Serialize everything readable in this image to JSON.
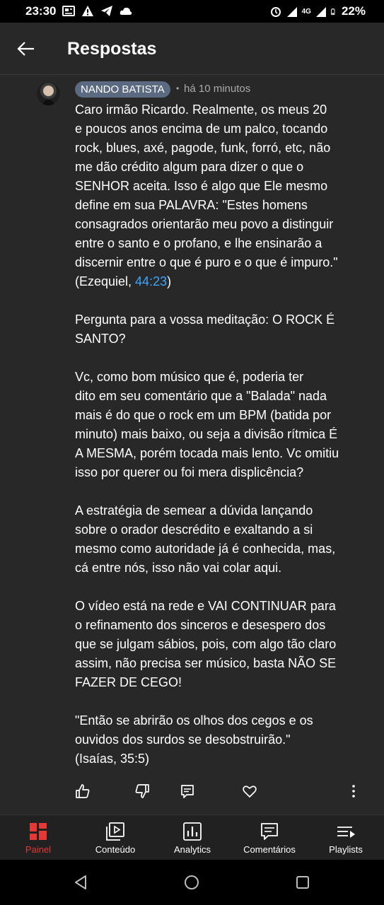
{
  "status_bar": {
    "time": "23:30",
    "battery": "22%",
    "network": "4G",
    "icons_left": [
      "news-icon",
      "alert-icon",
      "telegram-icon",
      "cloud-icon"
    ],
    "icons_right": [
      "alarm-icon",
      "signal-icon",
      "battery-icon"
    ]
  },
  "appbar": {
    "title": "Respostas"
  },
  "comment": {
    "author": "NANDO BATISTA",
    "separator": "•",
    "time": "há 10 minutos",
    "paragraphs": [
      {
        "lines": [
          "Caro irmão Ricardo. Realmente, os meus 20",
          "e poucos anos encima de um palco, tocando",
          "rock, blues, axé, pagode, funk, forró, etc, não",
          "me dão crédito algum para dizer o que o",
          "SENHOR aceita. Isso é algo que Ele mesmo",
          "define em sua PALAVRA: \"Estes homens",
          "consagrados orientarão meu povo a distinguir",
          "entre o santo e o profano, e lhe ensinarão a",
          "discernir entre o que é puro e o que é impuro.\""
        ],
        "last_line_prefix": "(Ezequiel, ",
        "last_line_link": "44:23",
        "last_line_suffix": ")"
      },
      {
        "lines": [
          "Pergunta para a vossa meditação: O ROCK É",
          "SANTO?"
        ]
      },
      {
        "lines": [
          "Vc, como bom músico que é, poderia ter",
          "dito em seu comentário que a \"Balada\" nada",
          "mais é do que o rock em um BPM (batida por",
          "minuto) mais baixo, ou seja a divisão rítmica É",
          "A MESMA, porém tocada mais lento. Vc omitiu",
          "isso por querer ou foi mera displicência?"
        ]
      },
      {
        "lines": [
          "A estratégia de semear a dúvida lançando",
          "sobre o orador descrédito e exaltando a si",
          "mesmo como autoridade já é conhecida, mas,",
          "cá entre nós, isso não vai colar aqui."
        ]
      },
      {
        "lines": [
          "O vídeo está na rede e VAI CONTINUAR para",
          "o refinamento dos sinceros e desespero dos",
          "que se julgam sábios, pois, com algo tão claro",
          "assim, não precisa ser músico, basta NÃO SE",
          "FAZER DE CEGO!"
        ]
      },
      {
        "lines": [
          "\"Então se abrirão os olhos dos cegos e os",
          "ouvidos dos surdos se desobstruirão.\"",
          "(Isaías, 35:5)"
        ]
      }
    ],
    "actions": [
      "like-icon",
      "dislike-icon",
      "reply-icon",
      "heart-icon",
      "more-icon"
    ]
  },
  "bottom_nav": {
    "items": [
      {
        "label": "Painel",
        "icon": "dashboard-icon",
        "active": true
      },
      {
        "label": "Conteúdo",
        "icon": "content-icon",
        "active": false
      },
      {
        "label": "Analytics",
        "icon": "analytics-icon",
        "active": false
      },
      {
        "label": "Comentários",
        "icon": "comments-icon",
        "active": false
      },
      {
        "label": "Playlists",
        "icon": "playlists-icon",
        "active": false
      }
    ]
  },
  "colors": {
    "background": "#282828",
    "author_chip": "#5b6a80",
    "link": "#3ea6ff",
    "active_nav": "#e53935",
    "meta_text": "#aaaaaa"
  }
}
